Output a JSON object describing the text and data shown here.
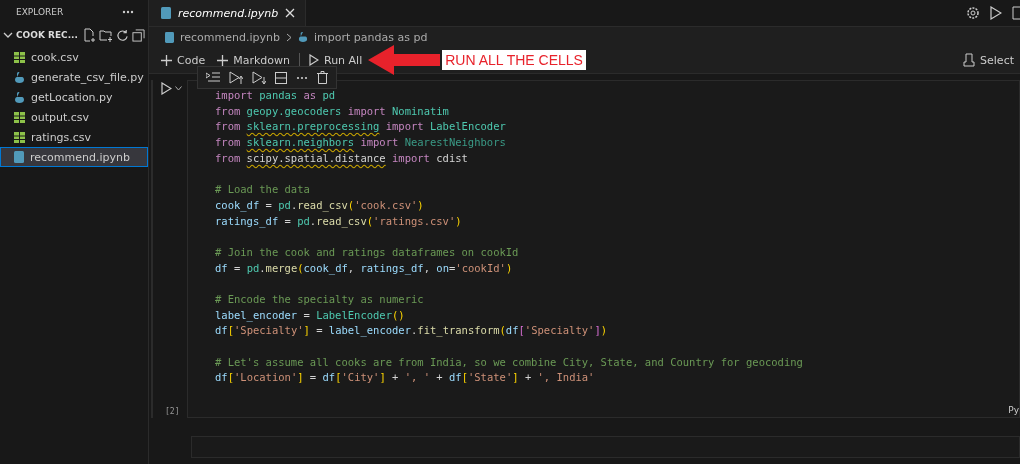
{
  "sidebar": {
    "title": "EXPLORER",
    "folder": {
      "name": "COOK REC...",
      "expanded": true
    },
    "files": [
      {
        "name": "cook.csv",
        "kind": "csv",
        "selected": false
      },
      {
        "name": "generate_csv_file.py",
        "kind": "py",
        "selected": false
      },
      {
        "name": "getLocation.py",
        "kind": "py",
        "selected": false
      },
      {
        "name": "output.csv",
        "kind": "csv",
        "selected": false
      },
      {
        "name": "ratings.csv",
        "kind": "csv",
        "selected": false
      },
      {
        "name": "recommend.ipynb",
        "kind": "nb",
        "selected": true
      }
    ]
  },
  "editor_tabs": [
    {
      "label": "recommend.ipynb",
      "selected": true
    }
  ],
  "breadcrumb": [
    {
      "label": "recommend.ipynb",
      "kind": "nb"
    },
    {
      "label": "import pandas as pd",
      "kind": "py"
    }
  ],
  "toolbar": {
    "buttons": [
      {
        "label": "Code",
        "kind": "add"
      },
      {
        "label": "Markdown",
        "kind": "add"
      },
      {
        "label": "Run All",
        "kind": "run"
      }
    ],
    "kernel": "Select"
  },
  "annotation": {
    "text": "RUN ALL THE CELLS"
  },
  "cell": {
    "execution_count": "[2]",
    "language": "Py",
    "blocks": [
      [
        [
          {
            "text": "import ",
            "kind": "kw"
          },
          {
            "text": "pandas ",
            "kind": "mod"
          },
          {
            "text": "as ",
            "kind": "kw"
          },
          {
            "text": "pd",
            "kind": "mod"
          }
        ],
        [
          {
            "text": "from ",
            "kind": "kw"
          },
          {
            "text": "geopy.geocoders ",
            "kind": "mod"
          },
          {
            "text": "import ",
            "kind": "kw"
          },
          {
            "text": "Nominatim",
            "kind": "mod"
          }
        ],
        [
          {
            "text": "from ",
            "kind": "kw"
          },
          {
            "text": "sklearn.preprocessing",
            "kind": "mod",
            "warn": true
          },
          {
            "text": " import ",
            "kind": "kw"
          },
          {
            "text": "LabelEncoder",
            "kind": "mod"
          }
        ],
        [
          {
            "text": "from ",
            "kind": "kw"
          },
          {
            "text": "sklearn.neighbors",
            "kind": "mod",
            "warn": true
          },
          {
            "text": " import ",
            "kind": "kw"
          },
          {
            "text": "NearestNeighbors",
            "kind": "dim"
          }
        ],
        [
          {
            "text": "from ",
            "kind": "kw"
          },
          {
            "text": "scipy.spatial.distance",
            "kind": "plain",
            "warn": true
          },
          {
            "text": " import ",
            "kind": "kw"
          },
          {
            "text": "cdist",
            "kind": "plain"
          }
        ]
      ],
      [
        [
          {
            "text": "# Load the data",
            "kind": "cmt"
          }
        ],
        [
          {
            "text": "cook_df",
            "kind": "var"
          },
          {
            "text": " = ",
            "kind": "plain"
          },
          {
            "text": "pd",
            "kind": "mod"
          },
          {
            "text": ".",
            "kind": "plain"
          },
          {
            "text": "read_csv",
            "kind": "fn"
          },
          {
            "text": "(",
            "kind": "br"
          },
          {
            "text": "'cook.csv'",
            "kind": "str"
          },
          {
            "text": ")",
            "kind": "br"
          }
        ],
        [
          {
            "text": "ratings_df",
            "kind": "var"
          },
          {
            "text": " = ",
            "kind": "plain"
          },
          {
            "text": "pd",
            "kind": "mod"
          },
          {
            "text": ".",
            "kind": "plain"
          },
          {
            "text": "read_csv",
            "kind": "fn"
          },
          {
            "text": "(",
            "kind": "br"
          },
          {
            "text": "'ratings.csv'",
            "kind": "str"
          },
          {
            "text": ")",
            "kind": "br"
          }
        ]
      ],
      [
        [
          {
            "text": "# Join the cook and ratings dataframes on cookId",
            "kind": "cmt"
          }
        ],
        [
          {
            "text": "df",
            "kind": "var"
          },
          {
            "text": " = ",
            "kind": "plain"
          },
          {
            "text": "pd",
            "kind": "mod"
          },
          {
            "text": ".",
            "kind": "plain"
          },
          {
            "text": "merge",
            "kind": "fn"
          },
          {
            "text": "(",
            "kind": "br"
          },
          {
            "text": "cook_df",
            "kind": "var"
          },
          {
            "text": ", ",
            "kind": "plain"
          },
          {
            "text": "ratings_df",
            "kind": "var"
          },
          {
            "text": ", ",
            "kind": "plain"
          },
          {
            "text": "on",
            "kind": "var"
          },
          {
            "text": "=",
            "kind": "plain"
          },
          {
            "text": "'cookId'",
            "kind": "str"
          },
          {
            "text": ")",
            "kind": "br"
          }
        ]
      ],
      [
        [
          {
            "text": "# Encode the specialty as numeric",
            "kind": "cmt"
          }
        ],
        [
          {
            "text": "label_encoder",
            "kind": "var"
          },
          {
            "text": " = ",
            "kind": "plain"
          },
          {
            "text": "LabelEncoder",
            "kind": "mod"
          },
          {
            "text": "()",
            "kind": "br"
          }
        ],
        [
          {
            "text": "df",
            "kind": "var"
          },
          {
            "text": "[",
            "kind": "br"
          },
          {
            "text": "'Specialty'",
            "kind": "str"
          },
          {
            "text": "]",
            "kind": "br"
          },
          {
            "text": " = ",
            "kind": "plain"
          },
          {
            "text": "label_encoder",
            "kind": "var"
          },
          {
            "text": ".",
            "kind": "plain"
          },
          {
            "text": "fit_transform",
            "kind": "fn"
          },
          {
            "text": "(",
            "kind": "br"
          },
          {
            "text": "df",
            "kind": "var"
          },
          {
            "text": "[",
            "kind": "br2"
          },
          {
            "text": "'Specialty'",
            "kind": "str"
          },
          {
            "text": "]",
            "kind": "br2"
          },
          {
            "text": ")",
            "kind": "br"
          }
        ]
      ],
      [
        [
          {
            "text": "# Let's assume all cooks are from India, so we combine City, State, and Country for geocoding",
            "kind": "cmt"
          }
        ],
        [
          {
            "text": "df",
            "kind": "var"
          },
          {
            "text": "[",
            "kind": "br"
          },
          {
            "text": "'Location'",
            "kind": "str"
          },
          {
            "text": "]",
            "kind": "br"
          },
          {
            "text": " = ",
            "kind": "plain"
          },
          {
            "text": "df",
            "kind": "var"
          },
          {
            "text": "[",
            "kind": "br"
          },
          {
            "text": "'City'",
            "kind": "str"
          },
          {
            "text": "]",
            "kind": "br"
          },
          {
            "text": " + ",
            "kind": "plain"
          },
          {
            "text": "', '",
            "kind": "str"
          },
          {
            "text": " + ",
            "kind": "plain"
          },
          {
            "text": "df",
            "kind": "var"
          },
          {
            "text": "[",
            "kind": "br"
          },
          {
            "text": "'State'",
            "kind": "str"
          },
          {
            "text": "]",
            "kind": "br"
          },
          {
            "text": " + ",
            "kind": "plain"
          },
          {
            "text": "', India'",
            "kind": "str"
          }
        ]
      ]
    ]
  }
}
